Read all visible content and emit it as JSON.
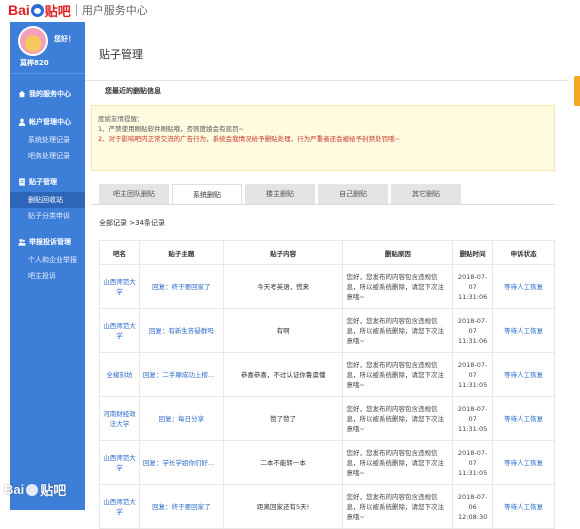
{
  "header": {
    "logo_bai": "Bai",
    "logo_tieba": "贴吧",
    "site_name": "用户服务中心"
  },
  "sidebar": {
    "hello": "您好！",
    "username": "莫桦820",
    "menu": [
      {
        "type": "head",
        "label": "我的服务中心",
        "icon": "home-icon"
      },
      {
        "type": "head",
        "label": "帐户管理中心",
        "icon": "user-icon"
      },
      {
        "type": "item",
        "label": "系统处理记录"
      },
      {
        "type": "item",
        "label": "吧务处理记录"
      },
      {
        "type": "head",
        "label": "贴子管理",
        "icon": "document-icon"
      },
      {
        "type": "item",
        "label": "删贴回收站",
        "active": true
      },
      {
        "type": "item",
        "label": "贴子分类申诉"
      },
      {
        "type": "head",
        "label": "举报投诉管理",
        "icon": "people-icon"
      },
      {
        "type": "item",
        "label": "个人和企业举报"
      },
      {
        "type": "item",
        "label": "吧主投诉"
      }
    ]
  },
  "main": {
    "title": "贴子管理",
    "section_label": "您最近的删贴信息",
    "notice": {
      "title": "度娘友情提醒：",
      "line1": "1、严禁使用刷贴软件刷贴哦，否则度娘会有惩罚~",
      "line2": "2、对于影响吧内正常交流的广告行为，系统会我情况给予删贴处理，行为严重者还会被给予封禁处罚哦~"
    },
    "tabs": [
      "吧主团队删贴",
      "系统删贴",
      "楼主删贴",
      "自己删贴",
      "其它删贴"
    ],
    "active_tab": 1,
    "total_prefix": "全部记录 >",
    "total_count": "34条记录",
    "columns": [
      "吧名",
      "贴子主题",
      "贴子内容",
      "删贴原因",
      "删贴时间",
      "申诉状态"
    ],
    "rows": [
      {
        "bar": "山西师范大学",
        "subject": "回复：终于要回家了",
        "content": "今天考英语，慌来",
        "reason": "您好，您发布的内容包含违规信息，所以被系统删除，请您下次注意哦~",
        "time": "2018-07-07 11:31:06",
        "status": "等待人工恢复"
      },
      {
        "bar": "山西师范大学",
        "subject": "回复：有新生答疑群吗",
        "content": "有啊",
        "reason": "您好，您发布的内容包含违规信息，所以被系统删除，请您下次注意哦~",
        "time": "2018-07-07 11:31:06",
        "status": "等待人工恢复"
      },
      {
        "bar": "全椒刻坊",
        "subject": "回复：二手摩成功上榜，…",
        "content": "恭喜恭喜，不过认证你鲁虞懂",
        "reason": "您好，您发布的内容包含违规信息，所以被系统删除，请您下次注意哦~",
        "time": "2018-07-07 11:31:05",
        "status": "等待人工恢复"
      },
      {
        "bar": "河南财经政法大学",
        "subject": "回复：每日分享",
        "content": "赞了赞了",
        "reason": "您好，您发布的内容包含违规信息，所以被系统删除，请您下次注意哦~",
        "time": "2018-07-07 11:31:05",
        "status": "等待人工恢复"
      },
      {
        "bar": "山西师范大学",
        "subject": "回复：学长学姐你们好，…",
        "content": "二本不能转一本",
        "reason": "您好，您发布的内容包含违规信息，所以被系统删除，请您下次注意哦~",
        "time": "2018-07-07 11:31:05",
        "status": "等待人工恢复"
      },
      {
        "bar": "山西师范大学",
        "subject": "回复：终于要回家了",
        "content": "距离回家还有5天!",
        "reason": "您好，您发布的内容包含违规信息，所以被系统删除，请您下次注意哦~",
        "time": "2018-07-06 12:08:30",
        "status": "等待人工恢复"
      }
    ]
  },
  "watermark": {
    "bai": "Bai",
    "tieba": "贴吧"
  }
}
